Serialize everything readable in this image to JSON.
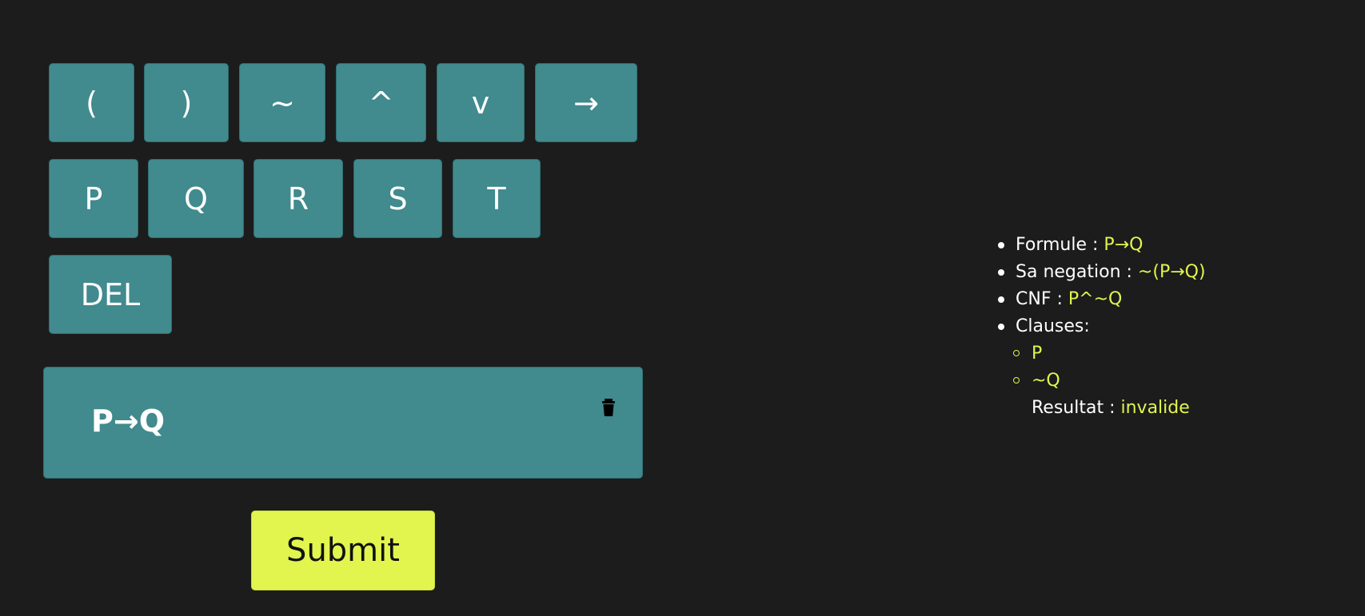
{
  "keypad": {
    "operators": [
      "(",
      ")",
      "~",
      "^",
      "v",
      "→"
    ],
    "variables": [
      "P",
      "Q",
      "R",
      "S",
      "T"
    ],
    "delete_label": "DEL"
  },
  "formula": {
    "value": "P→Q",
    "clear_icon": "trash-icon"
  },
  "submit_label": "Submit",
  "results": {
    "formule_label": "Formule :",
    "formule_value": "P→Q",
    "negation_label": "Sa negation :",
    "negation_value": "~(P→Q)",
    "cnf_label": "CNF :",
    "cnf_value": "P^~Q",
    "clauses_label": "Clauses:",
    "clauses": [
      "P",
      "~Q"
    ],
    "resultat_label": "Resultat :",
    "resultat_value": "invalide"
  },
  "colors": {
    "background": "#1c1c1c",
    "key": "#418a8e",
    "accent": "#e1f54e",
    "text": "#ffffff"
  }
}
